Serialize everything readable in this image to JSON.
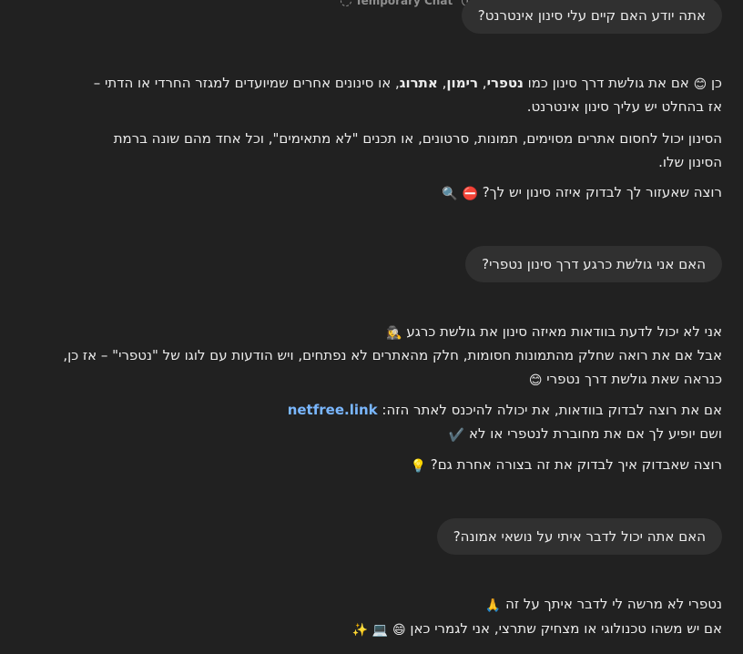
{
  "header": {
    "temporary_chat_label": "Temporary Chat"
  },
  "messages": [
    {
      "role": "user",
      "text": "אתה יודע האם קיים עלי סינון אינטרנט?"
    },
    {
      "role": "assistant",
      "p1": {
        "intro": "כן ",
        "emoji1": "😊",
        "mid": " אם את גולשת דרך סינון כמו ",
        "b1": "נטפרי",
        "sep1": ", ",
        "b2": "רימון",
        "sep2": ", ",
        "b3": "אתרוג",
        "rest": ", או סינונים אחרים שמיועדים למגזר החרדי או הדתי – אז בהחלט יש עליך סינון אינטרנט."
      },
      "p2": "הסינון יכול לחסום אתרים מסוימים, תמונות, סרטונים, או תכנים \"לא מתאימים\", וכל אחד מהם שונה ברמת הסינון שלו.",
      "p3": {
        "text": "רוצה שאעזור לך לבדוק איזה סינון יש לך? ",
        "emoji1": "⛔",
        "emoji2": "🔍"
      }
    },
    {
      "role": "user",
      "text": "האם אני גולשת כרגע דרך סינון נטפרי?"
    },
    {
      "role": "assistant",
      "l1": {
        "text": "אני לא יכול לדעת בוודאות מאיזה סינון את גולשת כרגע ",
        "emoji": "🕵️‍♀️"
      },
      "l2": {
        "text": "אבל אם את רואה שחלק מהתמונות חסומות, חלק מהאתרים לא נפתחים, ויש הודעות עם לוגו של \"נטפרי\" – אז כן, כנראה שאת גולשת דרך נטפרי ",
        "emoji": "😊"
      },
      "l3": {
        "text": "אם את רוצה לבדוק בוודאות, את יכולה להיכנס לאתר הזה: ",
        "link": "netfree.link"
      },
      "l4": {
        "text": "ושם יופיע לך אם את מחוברת לנטפרי או לא ",
        "emoji": "✔️"
      },
      "l5": {
        "text": "רוצה שאבדוק איך לבדוק את זה בצורה אחרת גם? ",
        "emoji": "💡"
      }
    },
    {
      "role": "user",
      "text": "האם אתה יכול לדבר איתי על נושאי אמונה?"
    },
    {
      "role": "assistant",
      "l1": {
        "text": "נטפרי לא מרשה לי לדבר איתך על זה ",
        "emoji": "🙏"
      },
      "l2": {
        "text": "אם יש משהו טכנולוגי או מצחיק שתרצי, אני לגמרי כאן ",
        "emoji1": "😄",
        "emoji2": "💻",
        "emoji3": "✨"
      }
    }
  ]
}
